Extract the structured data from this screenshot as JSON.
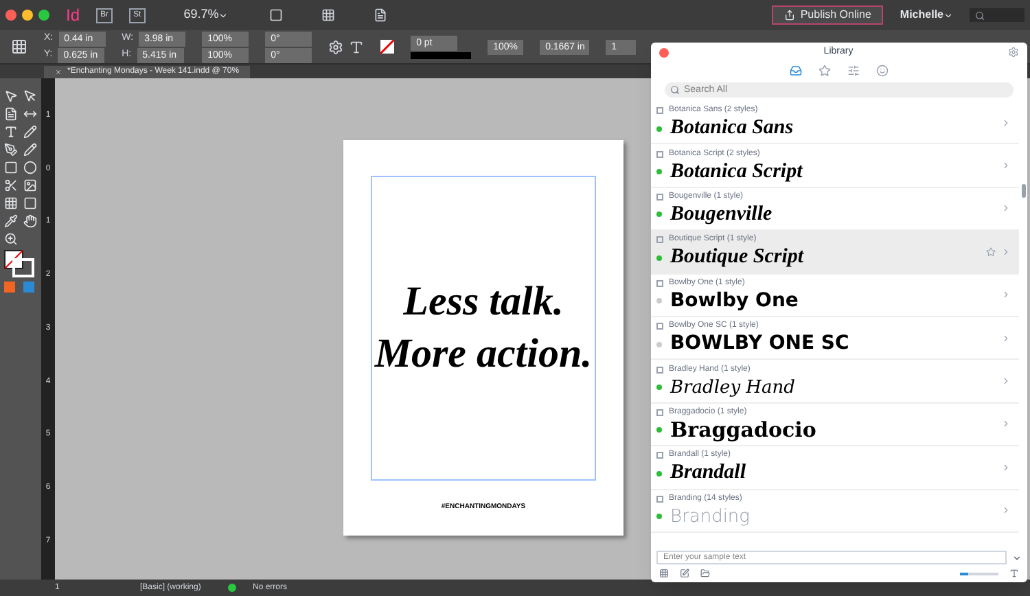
{
  "app_bar": {
    "app_icon": "Id",
    "bridge": "Br",
    "stock": "St",
    "zoom": "69.7%",
    "publish_button": "Publish Online",
    "user": "Michelle"
  },
  "control_bar": {
    "position": [
      {
        "label": "X:",
        "value": "0.44 in"
      },
      {
        "label": "Y:",
        "value": "0.625 in"
      }
    ],
    "size": [
      {
        "label": "W:",
        "value": "3.98 in"
      },
      {
        "label": "H:",
        "value": "5.415 in"
      }
    ],
    "scale": [
      "100%",
      "100%"
    ],
    "angles": [
      "0°",
      "0°"
    ],
    "stroke_weight": "0 pt",
    "opacity": "100%",
    "offset": "0.1667 in",
    "columns": "1"
  },
  "document_tab": {
    "title": "*Enchanting Mondays - Week 141.indd @ 70%"
  },
  "vertical_ruler": [
    "1",
    "0",
    "1",
    "2",
    "3",
    "4",
    "5",
    "6",
    "7"
  ],
  "page": {
    "lines": [
      "Less talk.",
      "More action."
    ],
    "hashtag": "#ENCHANTINGMONDAYS"
  },
  "library": {
    "title": "Library",
    "tabs": [
      {
        "kind": "inbox",
        "selected": true
      },
      {
        "kind": "star",
        "selected": false
      },
      {
        "kind": "filter",
        "selected": false
      },
      {
        "kind": "smile",
        "selected": false
      }
    ],
    "search": {
      "placeholder": "Search All"
    },
    "fonts": [
      {
        "name": "Botanica Sans (2 styles)",
        "sample": "Botanica Sans",
        "kind": "script",
        "color": "#2ebd3a",
        "selected": false
      },
      {
        "name": "Botanica Script (2 styles)",
        "sample": "Botanica Script",
        "kind": "script",
        "color": "#2ebd3a",
        "selected": false
      },
      {
        "name": "Bougenville (1 style)",
        "sample": "Bougenville",
        "kind": "script",
        "color": "#2ebd3a",
        "selected": false
      },
      {
        "name": "Boutique Script (1 style)",
        "sample": "Boutique Script",
        "kind": "script",
        "color": "#2ebd3a",
        "selected": true
      },
      {
        "name": "Bowlby One (1 style)",
        "sample": "Bowlby One",
        "kind": "heavy",
        "color": "#cccccc",
        "selected": false
      },
      {
        "name": "Bowlby One SC (1 style)",
        "sample": "BOWLBY ONE SC",
        "kind": "heavy",
        "color": "#cccccc",
        "selected": false
      },
      {
        "name": "Bradley Hand (1 style)",
        "sample": "Bradley Hand",
        "kind": "hand",
        "color": "#2ebd3a",
        "selected": false
      },
      {
        "name": "Braggadocio (1 style)",
        "sample": "Braggadocio",
        "kind": "stencil",
        "color": "#2ebd3a",
        "selected": false
      },
      {
        "name": "Brandall (1 style)",
        "sample": "Brandall",
        "kind": "script",
        "color": "#2ebd3a",
        "selected": false
      },
      {
        "name": "Branding (14 styles)",
        "sample": "Branding",
        "kind": "light",
        "color": "#2ebd3a",
        "selected": false
      }
    ],
    "sample_field": {
      "placeholder": "Enter your sample text"
    },
    "size_slider": {
      "level": 0.2
    }
  },
  "status_bar": {
    "page": "1",
    "style": "[Basic] (working)",
    "preflight": "No errors",
    "preflight_ok": true
  }
}
